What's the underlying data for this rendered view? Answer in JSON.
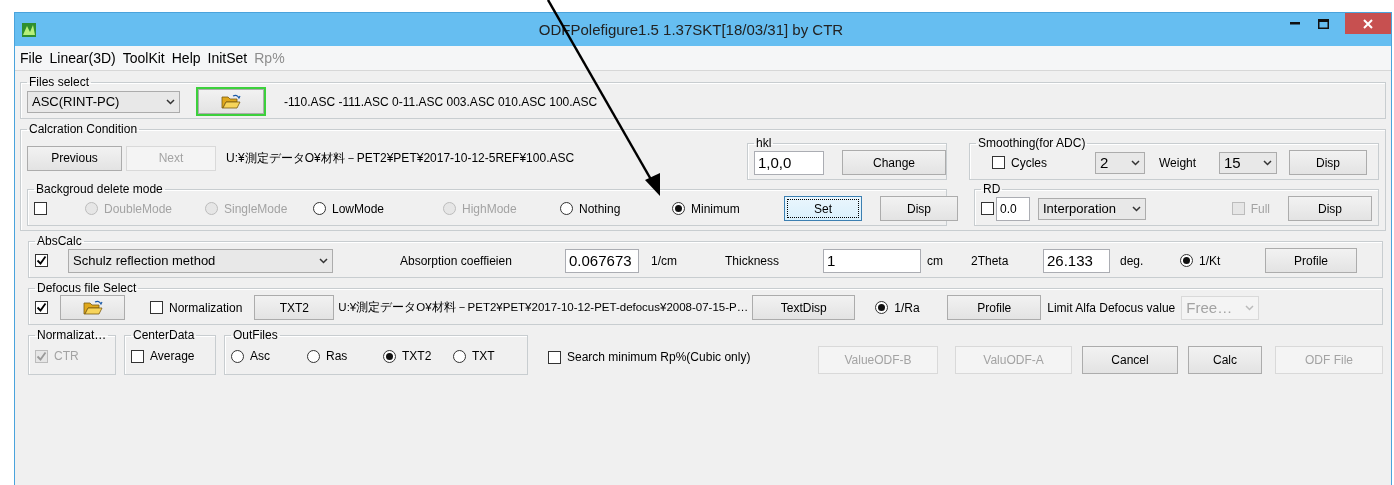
{
  "window": {
    "title": "ODFPolefigure1.5 1.37SKT[18/03/31] by CTR"
  },
  "menu": [
    {
      "label": "File",
      "disabled": false
    },
    {
      "label": "Linear(3D)",
      "disabled": false
    },
    {
      "label": "ToolKit",
      "disabled": false
    },
    {
      "label": "Help",
      "disabled": false
    },
    {
      "label": "InitSet",
      "disabled": false
    },
    {
      "label": "Rp%",
      "disabled": true
    }
  ],
  "files_select": {
    "title": "Files select",
    "format": "ASC(RINT-PC)",
    "open_focused": true,
    "files": "-110.ASC -111.ASC 0-11.ASC 003.ASC 010.ASC 100.ASC"
  },
  "calculation_condition": {
    "title": "Calcration Condition",
    "nav_buttons": [
      {
        "label": "Previous",
        "disabled": false
      },
      {
        "label": "Next",
        "disabled": true
      }
    ],
    "path": "U:¥測定データO¥材料－PET2¥PET¥2017-10-12-5REF¥100.ASC",
    "hkl": {
      "title": "hkl",
      "value": "1,0,0",
      "button": "Change"
    },
    "smoothing": {
      "title": "Smoothing(for ADC)",
      "checked": false,
      "cycles_label": "Cycles",
      "cycles": "2",
      "weight_label": "Weight",
      "weight": "15",
      "button": "Disp"
    },
    "background": {
      "title": "Backgroud delete mode",
      "checked": false,
      "options": [
        {
          "label": "DoubleMode",
          "selected": false,
          "disabled": true
        },
        {
          "label": "SingleMode",
          "selected": false,
          "disabled": true
        },
        {
          "label": "LowMode",
          "selected": false,
          "disabled": false
        },
        {
          "label": "HighMode",
          "selected": false,
          "disabled": true
        },
        {
          "label": "Nothing",
          "selected": false,
          "disabled": false
        },
        {
          "label": "Minimum",
          "selected": true,
          "disabled": false
        }
      ],
      "buttons": [
        {
          "label": "Set",
          "focused": true
        },
        {
          "label": "Disp",
          "focused": false
        }
      ]
    },
    "rd": {
      "title": "RD",
      "checked": false,
      "value": "0.0",
      "method": "Interporation",
      "full_label": "Full",
      "full_checked": false,
      "full_disabled": true,
      "button": "Disp"
    }
  },
  "abs_calc": {
    "title": "AbsCalc",
    "checked": true,
    "method": "Schulz reflection method",
    "coef_label": "Absorption coeffieien",
    "coef": "0.067673",
    "coef_unit": "1/cm",
    "thickness_label": "Thickness",
    "thickness": "1",
    "thickness_unit": "cm",
    "theta_label": "2Theta",
    "theta": "26.133",
    "theta_unit": "deg.",
    "kt_label": "1/Kt",
    "kt_selected": true,
    "button": "Profile"
  },
  "defocus": {
    "title": "Defocus file Select",
    "checked": true,
    "normalization_label": "Normalization",
    "normalization_checked": false,
    "txt_button": "TXT2",
    "path": "U:¥測定データO¥材料－PET2¥PET¥2017-10-12-PET-defocus¥2008-07-15-P…",
    "text_disp": "TextDisp",
    "ra_label": "1/Ra",
    "ra_selected": true,
    "button": "Profile",
    "limit_label": "Limit Alfa Defocus value",
    "limit_value": "Free…",
    "limit_disabled": true
  },
  "normalization": {
    "title": "Normalizat…",
    "label": "CTR",
    "checked": true,
    "disabled": true
  },
  "center_data": {
    "title": "CenterData",
    "label": "Average",
    "checked": false
  },
  "out_files": {
    "title": "OutFiles",
    "options": [
      {
        "label": "Asc",
        "selected": false
      },
      {
        "label": "Ras",
        "selected": false
      },
      {
        "label": "TXT2",
        "selected": true
      },
      {
        "label": "TXT",
        "selected": false
      }
    ]
  },
  "search_minimum": {
    "label": "Search minimum Rp%(Cubic only)",
    "checked": false
  },
  "actions": [
    {
      "label": "ValueODF-B",
      "disabled": true
    },
    {
      "label": "ValuODF-A",
      "disabled": true
    },
    {
      "label": "Cancel",
      "disabled": false
    },
    {
      "label": "Calc",
      "disabled": false
    },
    {
      "label": "ODF File",
      "disabled": true
    }
  ]
}
